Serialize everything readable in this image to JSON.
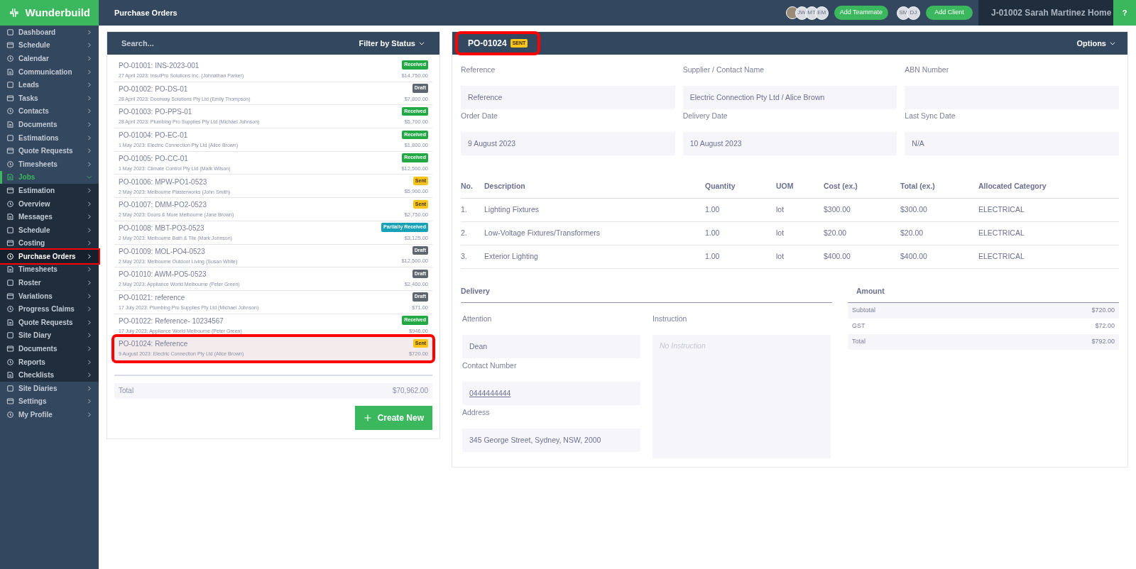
{
  "brand": "Wunderbuild",
  "page_title": "Purchase Orders",
  "topbar": {
    "avatars": [
      {
        "kind": "photo"
      },
      {
        "kind": "initials",
        "text": "JW"
      },
      {
        "kind": "initials",
        "text": "MT"
      },
      {
        "kind": "initials",
        "text": "EM"
      }
    ],
    "add_teammate": "Add Teammate",
    "client_avatars": [
      {
        "kind": "initials",
        "text": "SM"
      },
      {
        "kind": "initials",
        "text": "DJ"
      }
    ],
    "add_client": "Add Client",
    "job": "J-01002 Sarah Martinez Home",
    "help_icon": "?"
  },
  "sidebar": {
    "items": [
      {
        "label": "Dashboard",
        "selected": false,
        "expanded": false,
        "highlighted": false
      },
      {
        "label": "Schedule",
        "selected": false,
        "expanded": false,
        "highlighted": false
      },
      {
        "label": "Calendar",
        "selected": false,
        "expanded": false,
        "highlighted": false
      },
      {
        "label": "Communication",
        "selected": false,
        "expanded": false,
        "highlighted": false
      },
      {
        "label": "Leads",
        "selected": false,
        "expanded": false,
        "highlighted": false
      },
      {
        "label": "Tasks",
        "selected": false,
        "expanded": false,
        "highlighted": false
      },
      {
        "label": "Contacts",
        "selected": false,
        "expanded": false,
        "highlighted": false
      },
      {
        "label": "Documents",
        "selected": false,
        "expanded": false,
        "highlighted": false
      },
      {
        "label": "Estimations",
        "selected": false,
        "expanded": false,
        "highlighted": false
      },
      {
        "label": "Quote Requests",
        "selected": false,
        "expanded": false,
        "highlighted": false
      },
      {
        "label": "Timesheets",
        "selected": false,
        "expanded": false,
        "highlighted": false
      },
      {
        "label": "Jobs",
        "selected": true,
        "expanded": true,
        "highlighted": false,
        "children": [
          {
            "label": "Estimation",
            "selected": false,
            "highlighted": false
          },
          {
            "label": "Overview",
            "selected": false,
            "highlighted": false
          },
          {
            "label": "Messages",
            "selected": false,
            "highlighted": false
          },
          {
            "label": "Schedule",
            "selected": false,
            "highlighted": false
          },
          {
            "label": "Costing",
            "selected": false,
            "highlighted": false
          },
          {
            "label": "Purchase Orders",
            "selected": true,
            "highlighted": true
          },
          {
            "label": "Timesheets",
            "selected": false,
            "highlighted": false
          },
          {
            "label": "Roster",
            "selected": false,
            "highlighted": false
          },
          {
            "label": "Variations",
            "selected": false,
            "highlighted": false
          },
          {
            "label": "Progress Claims",
            "selected": false,
            "highlighted": false
          },
          {
            "label": "Quote Requests",
            "selected": false,
            "highlighted": false
          },
          {
            "label": "Site Diary",
            "selected": false,
            "highlighted": false
          },
          {
            "label": "Documents",
            "selected": false,
            "highlighted": false
          },
          {
            "label": "Reports",
            "selected": false,
            "highlighted": false
          },
          {
            "label": "Checklists",
            "selected": false,
            "highlighted": false
          }
        ]
      },
      {
        "label": "Site Diaries",
        "selected": false,
        "expanded": false,
        "highlighted": false
      },
      {
        "label": "Settings",
        "selected": false,
        "expanded": false,
        "highlighted": false
      },
      {
        "label": "My Profile",
        "selected": false,
        "expanded": false,
        "highlighted": false
      }
    ]
  },
  "list": {
    "search_placeholder": "Search...",
    "filter": "Filter by Status",
    "orders": [
      {
        "title": "PO-01001: INS-2023-001",
        "subtitle": "27 April 2023: InsulPro Solutions Inc. (Johnathan Parker)",
        "status": "Received",
        "kind": "received",
        "amount": "$14,750.00",
        "selected": false,
        "highlighted": false
      },
      {
        "title": "PO-01002: PO-DS-01",
        "subtitle": "28 April 2023: Doorway Solutions Pty Ltd (Emily Thompson)",
        "status": "Draft",
        "kind": "draft",
        "amount": "$7,800.00",
        "selected": false,
        "highlighted": false
      },
      {
        "title": "PO-01003: PO-PPS-01",
        "subtitle": "28 April 2023: Plumbing Pro Supplies Pty Ltd (Michael Johnson)",
        "status": "Received",
        "kind": "received",
        "amount": "$5,700.00",
        "selected": false,
        "highlighted": false
      },
      {
        "title": "PO-01004: PO-EC-01",
        "subtitle": "1 May 2023: Electric Connection Pty Ltd (Alice Brown)",
        "status": "Received",
        "kind": "received",
        "amount": "$1,800.00",
        "selected": false,
        "highlighted": false
      },
      {
        "title": "PO-01005: PO-CC-01",
        "subtitle": "1 May 2023: Climate Control Pty Ltd (Mark Wilson)",
        "status": "Received",
        "kind": "received",
        "amount": "$12,500.00",
        "selected": false,
        "highlighted": false
      },
      {
        "title": "PO-01006: MPW-PO1-0523",
        "subtitle": "2 May 2023: Melbourne Plasterworks (John Smith)",
        "status": "Sent",
        "kind": "sent",
        "amount": "$5,900.00",
        "selected": false,
        "highlighted": false
      },
      {
        "title": "PO-01007: DMM-PO2-0523",
        "subtitle": "2 May 2023: Doors & More Melbourne (Jane Brown)",
        "status": "Sent",
        "kind": "sent",
        "amount": "$2,750.00",
        "selected": false,
        "highlighted": false
      },
      {
        "title": "PO-01008: MBT-PO3-0523",
        "subtitle": "2 May 2023: Melbourne Bath & Tile (Mark Johnson)",
        "status": "Partially Received",
        "kind": "partial",
        "amount": "$3,125.00",
        "selected": false,
        "highlighted": false
      },
      {
        "title": "PO-01009: MOL-PO4-0523",
        "subtitle": "2 May 2023: Melbourne Outdoor Living (Susan White)",
        "status": "Draft",
        "kind": "draft",
        "amount": "$12,500.00",
        "selected": false,
        "highlighted": false
      },
      {
        "title": "PO-01010: AWM-PO5-0523",
        "subtitle": "2 May 2023: Appliance World Melbourne (Peter Green)",
        "status": "Draft",
        "kind": "draft",
        "amount": "$2,400.00",
        "selected": false,
        "highlighted": false
      },
      {
        "title": "PO-01021: reference",
        "subtitle": "17 July 2023: Plumbing Pro Supplies Pty Ltd (Michael Johnson)",
        "status": "Draft",
        "kind": "draft",
        "amount": "$71.00",
        "selected": false,
        "highlighted": false
      },
      {
        "title": "PO-01022: Reference- 10234567",
        "subtitle": "17 July 2023: Appliance World Melbourne (Peter Green)",
        "status": "Received",
        "kind": "received",
        "amount": "$946.00",
        "selected": false,
        "highlighted": false
      },
      {
        "title": "PO-01024: Reference",
        "subtitle": "9 August 2023: Electric Connection Pty Ltd (Alice Brown)",
        "status": "Sent",
        "kind": "sent",
        "amount": "$720.00",
        "selected": true,
        "highlighted": true
      }
    ],
    "total_label": "Total",
    "total": "$70,962.00",
    "create": "Create New"
  },
  "detail": {
    "number": "PO-01024",
    "badge": {
      "text": "SENT",
      "kind": "sent"
    },
    "highlighted": true,
    "options": "Options",
    "fields": [
      {
        "label": "Reference",
        "value": "Reference"
      },
      {
        "label": "Supplier / Contact Name",
        "value": "Electric Connection Pty Ltd / Alice Brown"
      },
      {
        "label": "ABN Number"
      },
      {
        "label": "Order Date",
        "value": "9 August 2023"
      },
      {
        "label": "Delivery Date",
        "value": "10 August 2023"
      },
      {
        "label": "Last Sync Date",
        "value": "N/A"
      }
    ],
    "table": {
      "columns": [
        "No.",
        "Description",
        "Quantity",
        "UOM",
        "Cost (ex.)",
        "Total (ex.)",
        "Allocated Category"
      ],
      "rows": [
        [
          "1.",
          "Lighting Fixtures",
          "1.00",
          "lot",
          "$300.00",
          "$300.00",
          "ELECTRICAL"
        ],
        [
          "2.",
          "Low-Voltage Fixtures/Transformers",
          "1.00",
          "lot",
          "$20.00",
          "$20.00",
          "ELECTRICAL"
        ],
        [
          "3.",
          "Exterior Lighting",
          "1.00",
          "lot",
          "$400.00",
          "$400.00",
          "ELECTRICAL"
        ]
      ]
    },
    "delivery": {
      "heading": "Delivery",
      "attention_label": "Attention",
      "attention": "Dean",
      "contact_label": "Contact Number",
      "contact": "0444444444",
      "address_label": "Address",
      "address": "345 George Street, Sydney, NSW, 2000",
      "instruction_label": "Instruction",
      "instruction_placeholder": "No Instruction"
    },
    "amount": {
      "heading": "Amount",
      "rows": [
        {
          "label": "Subtotal",
          "value": "$720.00"
        },
        {
          "label": "GST",
          "value": "$72.00"
        },
        {
          "label": "Total",
          "value": "$792.00"
        }
      ]
    }
  }
}
